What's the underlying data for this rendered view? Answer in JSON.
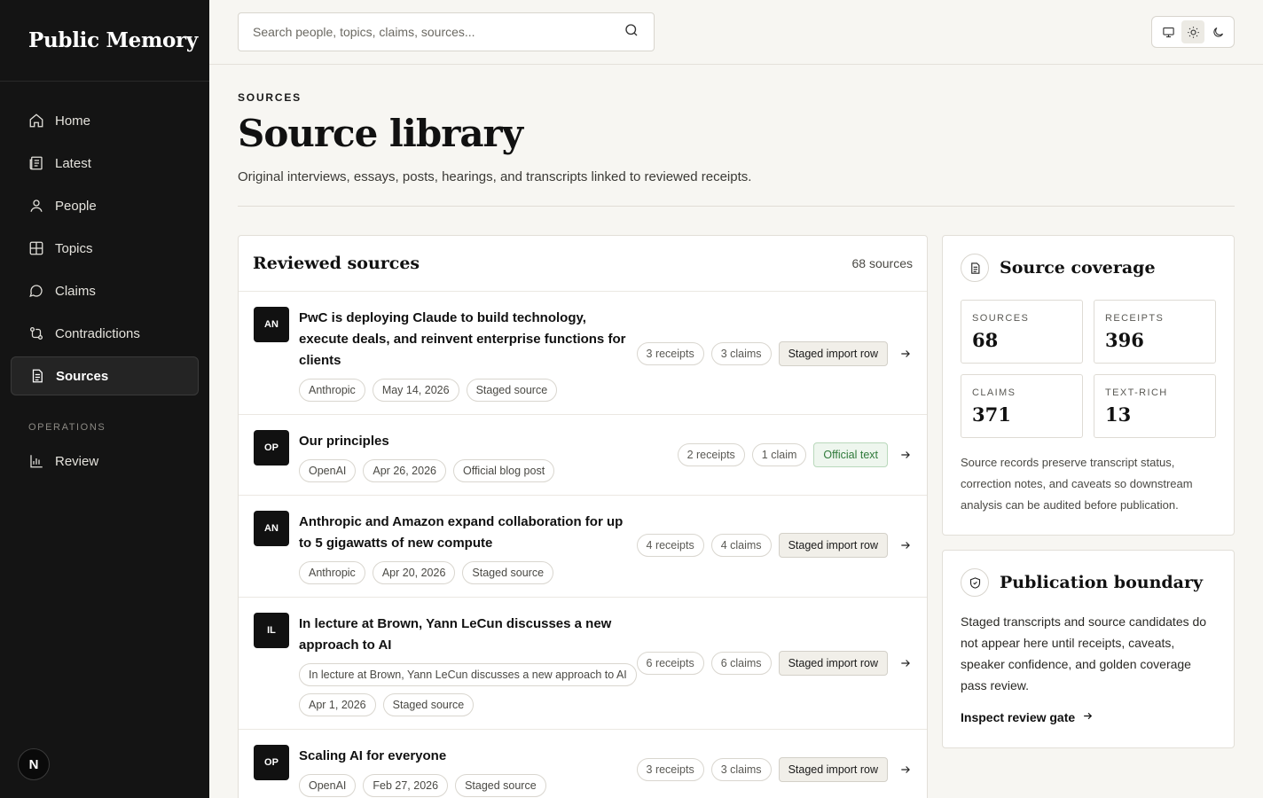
{
  "brand": "Public Memory",
  "nav": [
    {
      "label": "Home",
      "icon": "home-icon"
    },
    {
      "label": "Latest",
      "icon": "newspaper-icon"
    },
    {
      "label": "People",
      "icon": "person-icon"
    },
    {
      "label": "Topics",
      "icon": "grid-icon"
    },
    {
      "label": "Claims",
      "icon": "chat-bubble-icon"
    },
    {
      "label": "Contradictions",
      "icon": "git-compare-icon"
    },
    {
      "label": "Sources",
      "icon": "document-icon"
    }
  ],
  "nav_section": "OPERATIONS",
  "nav_ops": [
    {
      "label": "Review",
      "icon": "bar-chart-icon"
    }
  ],
  "avatar_initial": "N",
  "search": {
    "placeholder": "Search people, topics, claims, sources..."
  },
  "page": {
    "eyebrow": "SOURCES",
    "title": "Source library",
    "subtitle": "Original interviews, essays, posts, hearings, and transcripts linked to reviewed receipts."
  },
  "list": {
    "heading": "Reviewed sources",
    "count": "68 sources",
    "rows": [
      {
        "badge": "AN",
        "title": "PwC is deploying Claude to build technology, execute deals, and reinvent enterprise functions for clients",
        "tags": [
          "Anthropic",
          "May 14, 2026",
          "Staged source"
        ],
        "receipts": "3 receipts",
        "claims": "3 claims",
        "status": "Staged import row",
        "official": false
      },
      {
        "badge": "OP",
        "title": "Our principles",
        "tags": [
          "OpenAI",
          "Apr 26, 2026",
          "Official blog post"
        ],
        "receipts": "2 receipts",
        "claims": "1 claim",
        "status": "Official text",
        "official": true
      },
      {
        "badge": "AN",
        "title": "Anthropic and Amazon expand collaboration for up to 5 gigawatts of new compute",
        "tags": [
          "Anthropic",
          "Apr 20, 2026",
          "Staged source"
        ],
        "receipts": "4 receipts",
        "claims": "4 claims",
        "status": "Staged import row",
        "official": false
      },
      {
        "badge": "IL",
        "title": "In lecture at Brown, Yann LeCun discusses a new approach to AI",
        "tags": [
          "In lecture at Brown, Yann LeCun discusses a new approach to AI",
          "Apr 1, 2026",
          "Staged source"
        ],
        "receipts": "6 receipts",
        "claims": "6 claims",
        "status": "Staged import row",
        "official": false
      },
      {
        "badge": "OP",
        "title": "Scaling AI for everyone",
        "tags": [
          "OpenAI",
          "Feb 27, 2026",
          "Staged source"
        ],
        "receipts": "3 receipts",
        "claims": "3 claims",
        "status": "Staged import row",
        "official": false
      }
    ]
  },
  "coverage": {
    "title": "Source coverage",
    "stats": [
      {
        "label": "SOURCES",
        "value": "68"
      },
      {
        "label": "RECEIPTS",
        "value": "396"
      },
      {
        "label": "CLAIMS",
        "value": "371"
      },
      {
        "label": "TEXT-RICH",
        "value": "13"
      }
    ],
    "note": "Source records preserve transcript status, correction notes, and caveats so downstream analysis can be audited before publication."
  },
  "boundary": {
    "title": "Publication boundary",
    "body": "Staged transcripts and source candidates do not appear here until receipts, caveats, speaker confidence, and golden coverage pass review.",
    "link": "Inspect review gate"
  },
  "colors": {
    "sidebar": "#141414",
    "accent_green": "#2f7a3a",
    "background": "#f7f6f2"
  }
}
